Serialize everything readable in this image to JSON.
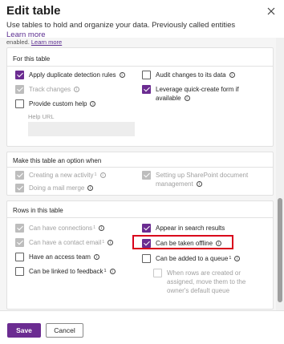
{
  "dialog": {
    "title": "Edit table",
    "subtitle": "Use tables to hold and organize your data. Previously called entities",
    "learn_more": "Learn more",
    "close_icon": "close-icon"
  },
  "cutoff": {
    "text": "enabled.",
    "link": "Learn more"
  },
  "for_this_table": {
    "title": "For this table",
    "items": [
      {
        "label": "Apply duplicate detection rules",
        "checked": true,
        "disabled": false,
        "info": true
      },
      {
        "label": "Track changes",
        "checked": true,
        "disabled": true,
        "info": true
      },
      {
        "label": "Provide custom help",
        "checked": false,
        "disabled": false,
        "info": true
      },
      {
        "label": "Audit changes to its data",
        "checked": false,
        "disabled": false,
        "info": true
      },
      {
        "label": "Leverage quick-create form if",
        "label2": "available",
        "checked": true,
        "disabled": false,
        "info": true
      }
    ],
    "help_url_label": "Help URL"
  },
  "option_when": {
    "title": "Make this table an option when",
    "items": [
      {
        "label": "Creating a new activity",
        "sup": "1",
        "checked": true,
        "disabled": true,
        "info": true
      },
      {
        "label": "Doing a mail merge",
        "checked": true,
        "disabled": true,
        "info": true
      },
      {
        "label": "Setting up SharePoint document",
        "label2": "management",
        "checked": true,
        "disabled": true,
        "info": true
      }
    ]
  },
  "rows_in_table": {
    "title": "Rows in this table",
    "items": [
      {
        "label": "Can have connections",
        "sup": "1",
        "checked": true,
        "disabled": true,
        "info": true
      },
      {
        "label": "Can have a contact email",
        "sup": "1",
        "checked": true,
        "disabled": true,
        "info": true
      },
      {
        "label": "Have an access team",
        "checked": false,
        "disabled": false,
        "info": true
      },
      {
        "label": "Can be linked to feedback",
        "sup": "1",
        "checked": false,
        "disabled": false,
        "info": true
      },
      {
        "label": "Appear in search results",
        "checked": true,
        "disabled": false,
        "info": false
      },
      {
        "label": "Can be taken offline",
        "checked": true,
        "disabled": false,
        "info": true
      },
      {
        "label": "Can be added to a queue",
        "sup": "1",
        "checked": false,
        "disabled": false,
        "info": true
      },
      {
        "label": "When rows are created or",
        "label2": "assigned, move them to the",
        "label3": "owner's default queue",
        "checked": false,
        "disabled": true,
        "info": false
      }
    ]
  },
  "footer": {
    "save": "Save",
    "cancel": "Cancel"
  },
  "colors": {
    "accent": "#6b2c91",
    "highlight": "#d9001b"
  }
}
